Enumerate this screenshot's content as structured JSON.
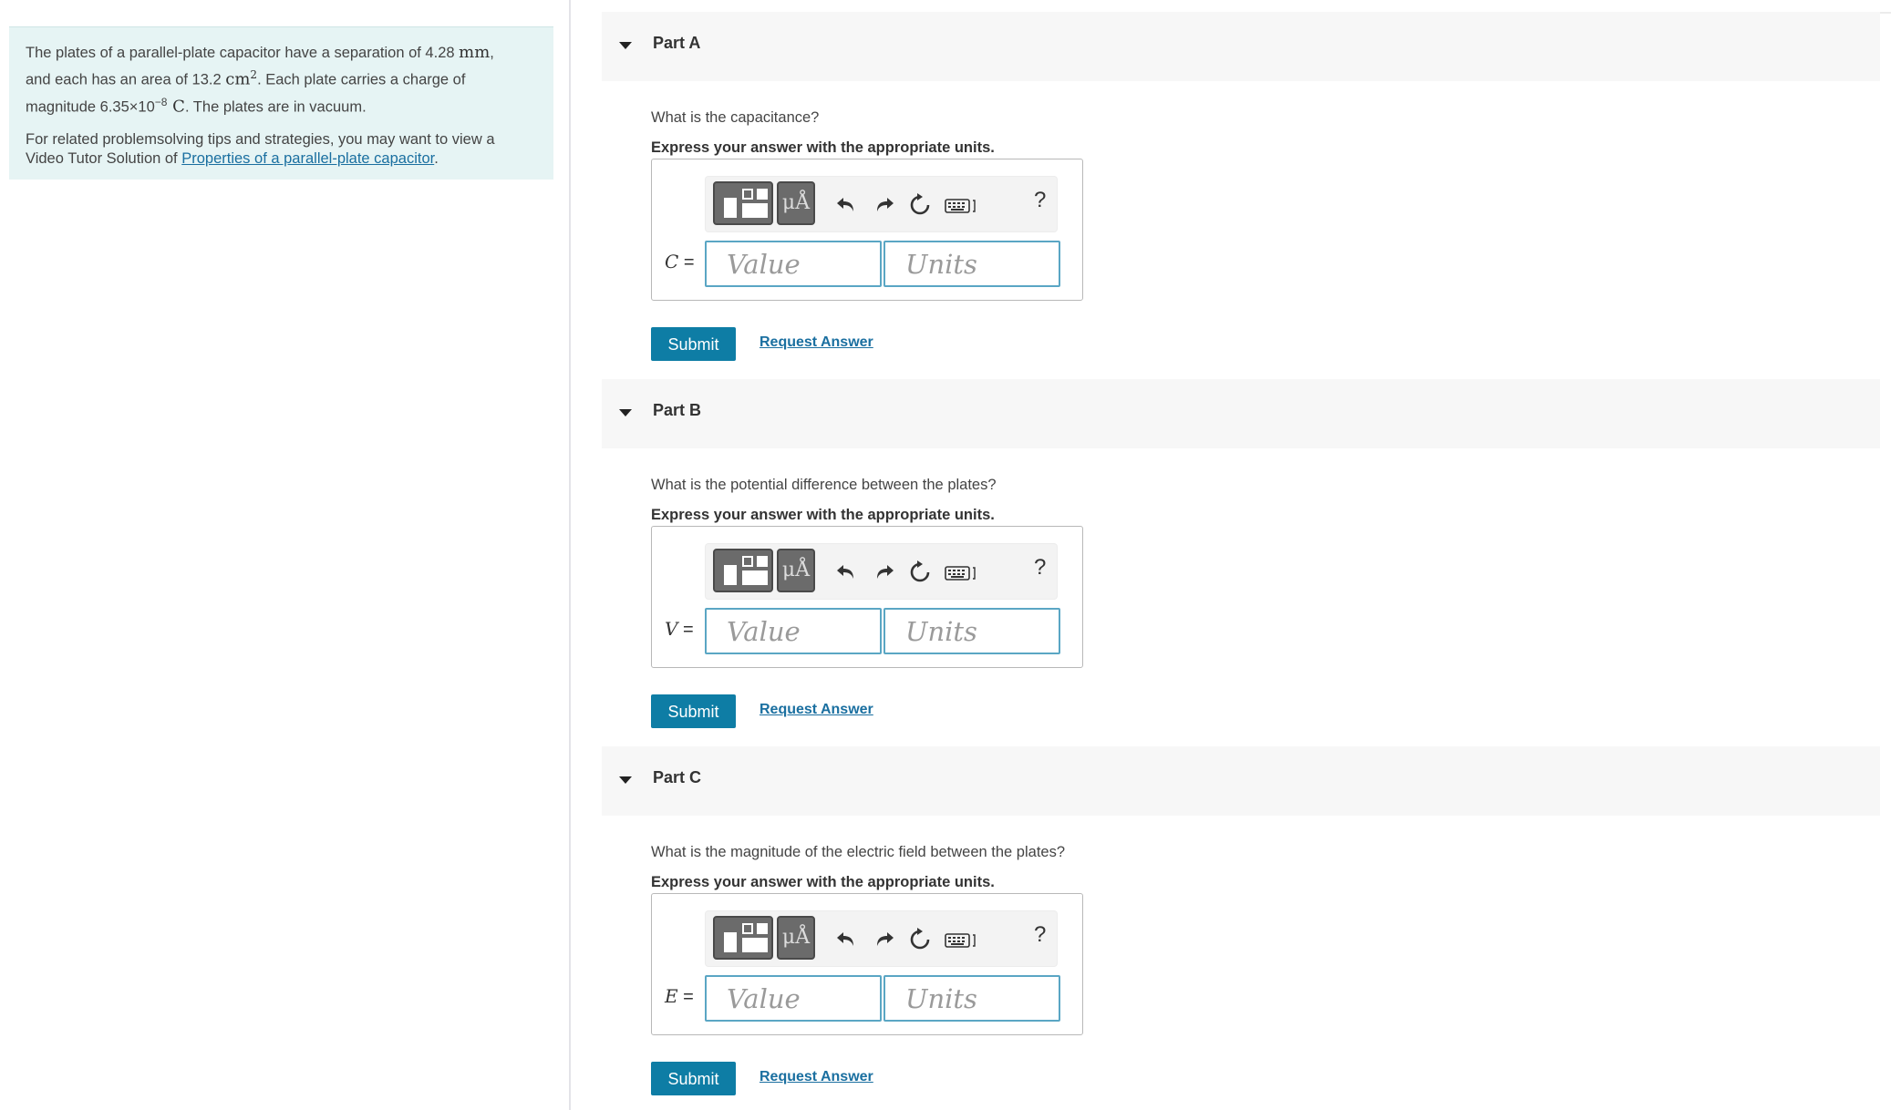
{
  "problem": {
    "p1_a": "The plates of a parallel-plate capacitor have a separation of 4.28 ",
    "p1_unit1": "mm",
    "p1_b": ",",
    "p1_c": "and each has an area of 13.2 ",
    "p1_unit2": "cm",
    "p1_exp2": "2",
    "p1_d": ". Each plate carries a charge of",
    "p1_e": "magnitude 6.35×10",
    "p1_exp3": "−8",
    "p1_unit3": " C",
    "p1_f": ". The plates are in vacuum.",
    "p2_a": "For related problemsolving tips and strategies, you may want to view a",
    "p2_b": "Video Tutor Solution of ",
    "p2_link": "Properties of a parallel-plate capacitor",
    "p2_c": "."
  },
  "toolbar": {
    "units_glyph": "μÅ",
    "help": "?",
    "icons": [
      "templates-icon",
      "units-icon",
      "undo-icon",
      "redo-icon",
      "reset-icon",
      "keyboard-icon",
      "help-icon"
    ]
  },
  "parts": [
    {
      "title": "Part A",
      "question": "What is the capacitance?",
      "instruction": "Express your answer with the appropriate units.",
      "var": "C",
      "eq": " =",
      "value_placeholder": "Value",
      "units_placeholder": "Units",
      "submit": "Submit",
      "request": "Request Answer"
    },
    {
      "title": "Part B",
      "question": "What is the potential difference between the plates?",
      "instruction": "Express your answer with the appropriate units.",
      "var": "V",
      "eq": " =",
      "value_placeholder": "Value",
      "units_placeholder": "Units",
      "submit": "Submit",
      "request": "Request Answer"
    },
    {
      "title": "Part C",
      "question": "What is the magnitude of the electric field between the plates?",
      "instruction": "Express your answer with the appropriate units.",
      "var": "E",
      "eq": " =",
      "value_placeholder": "Value",
      "units_placeholder": "Units",
      "submit": "Submit",
      "request": "Request Answer"
    }
  ]
}
